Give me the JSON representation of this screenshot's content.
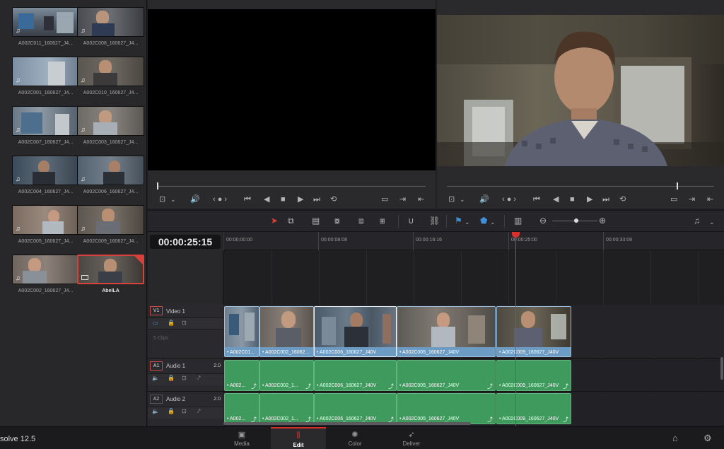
{
  "app": {
    "name": "solve 12.5"
  },
  "media_pool": {
    "clips": [
      {
        "name": "A002C011_160627_J4...",
        "has_audio": true
      },
      {
        "name": "A002C008_160627_J4...",
        "has_audio": true
      },
      {
        "name": "A002C001_160627_J4...",
        "has_audio": true
      },
      {
        "name": "A002C010_160627_J4...",
        "has_audio": true
      },
      {
        "name": "A002C007_160627_J4...",
        "has_audio": true
      },
      {
        "name": "A002C003_160627_J4...",
        "has_audio": true
      },
      {
        "name": "A002C004_160627_J4...",
        "has_audio": true
      },
      {
        "name": "A002C006_160627_J4...",
        "has_audio": true
      },
      {
        "name": "A002C005_160627_J4...",
        "has_audio": true
      },
      {
        "name": "A002C009_160627_J4...",
        "has_audio": true
      },
      {
        "name": "A002C002_160627_J4...",
        "has_audio": true
      },
      {
        "name": "AbelLA",
        "has_audio": false,
        "selected": true
      }
    ]
  },
  "viewer_controls": {
    "glyphs": [
      "⊡",
      "⌄",
      "🔊",
      "‹ ● ›",
      "⏮",
      "◀",
      "■",
      "▶",
      "⏭",
      "⟲",
      "▭",
      "⇥",
      "⇤"
    ]
  },
  "toolbar": {
    "icons": [
      "select-arrow-icon",
      "trim-icon",
      "blade-icon",
      "insert-clip-icon",
      "overwrite-clip-icon",
      "replace-clip-icon",
      "snapping-icon",
      "link-icon",
      "flag-icon",
      "marker-icon",
      "timeline-view-icon",
      "zoom-out-icon",
      "zoom-in-icon",
      "audio-icon"
    ]
  },
  "timeline": {
    "timecode": "00:00:25:15",
    "ruler": [
      "00:00:00:00",
      "00:00:08:08",
      "00:00:16:16",
      "00:00:25:00",
      "00:00:33:08"
    ],
    "tracks": {
      "v1": {
        "id": "V1",
        "name": "Video 1",
        "info": "5 Clips"
      },
      "a1": {
        "id": "A1",
        "name": "Audio 1",
        "channels": "2.0"
      },
      "a2": {
        "id": "A2",
        "name": "Audio 2",
        "channels": "2.0"
      }
    },
    "video_clips": [
      {
        "label": "• A002C01..."
      },
      {
        "label": "• A002C002_16062..."
      },
      {
        "label": "• A002C006_160627_J40V"
      },
      {
        "label": "• A002C005_160627_J40V"
      },
      {
        "label": "• A002C009_160627_J40V"
      }
    ],
    "audio1_clips": [
      {
        "label": "• A002..."
      },
      {
        "label": "• A002C002_1..."
      },
      {
        "label": "• A002C006_160627_J40V"
      },
      {
        "label": "• A002C005_160627_J40V"
      },
      {
        "label": "• A002C009_160627_J40V"
      }
    ],
    "audio2_clips": [
      {
        "label": "• A002..."
      },
      {
        "label": "• A002C002_1..."
      },
      {
        "label": "• A002C006_160627_J40V"
      },
      {
        "label": "• A002C005_160627_J40V"
      },
      {
        "label": "• A002C009_160627_J40V"
      }
    ]
  },
  "pages": [
    {
      "label": "Media",
      "icon": "▣"
    },
    {
      "label": "Edit",
      "icon": "⫼",
      "active": true
    },
    {
      "label": "Color",
      "icon": "✺"
    },
    {
      "label": "Deliver",
      "icon": "➶"
    }
  ],
  "colors": {
    "accent": "#d7312d",
    "video_clip": "#6c9bc4",
    "audio_clip": "#3f9a5d"
  }
}
